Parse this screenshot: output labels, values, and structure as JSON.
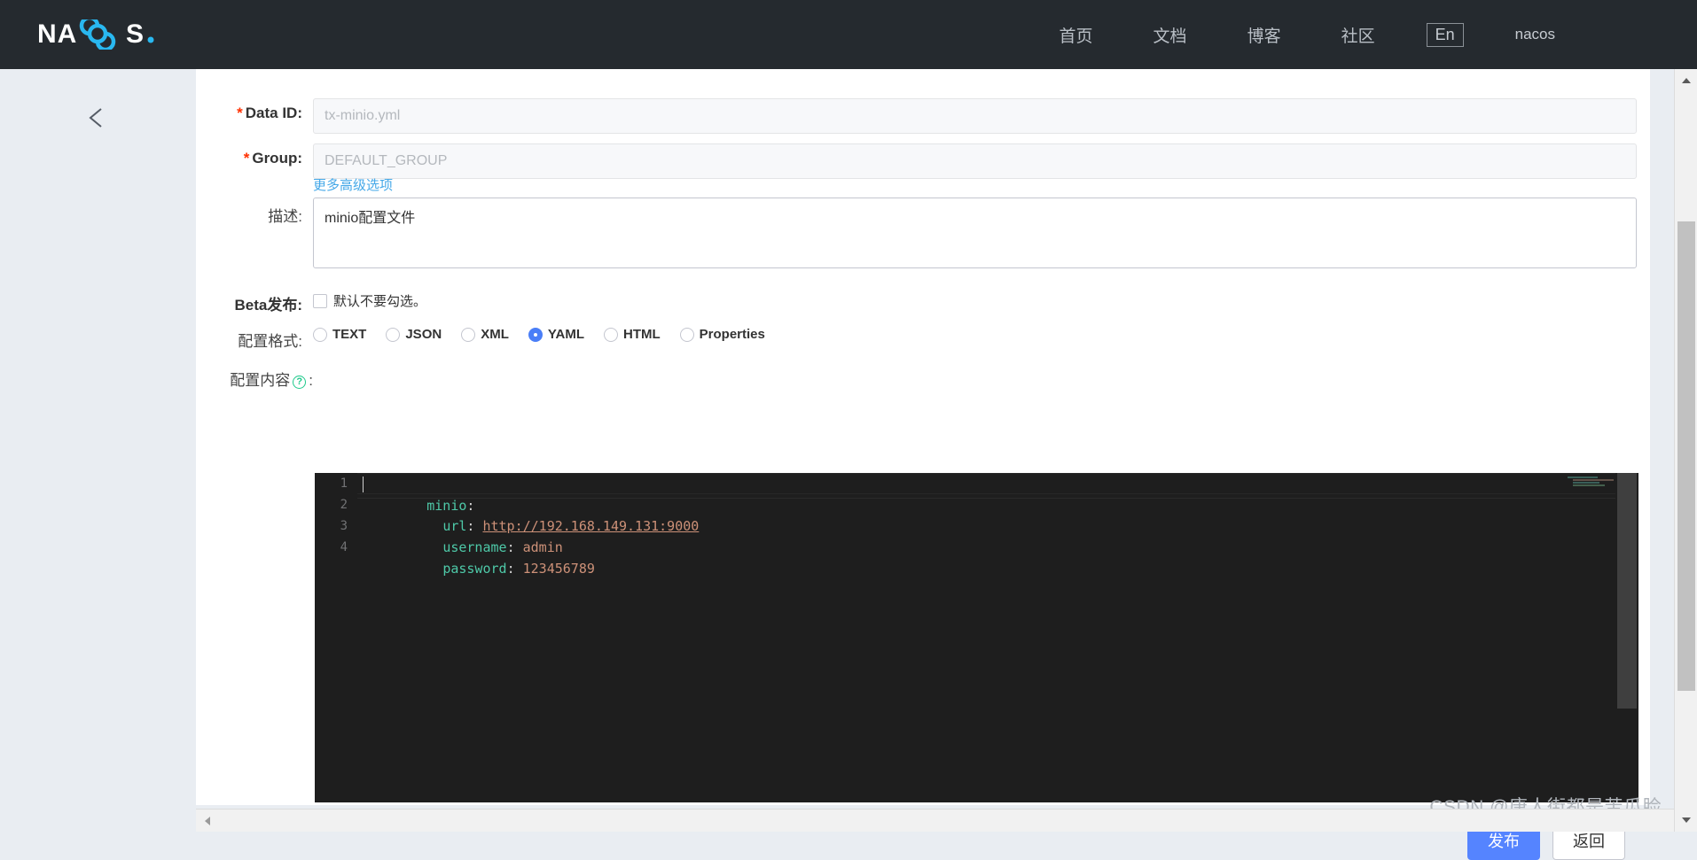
{
  "brand": {
    "name": "NACOS."
  },
  "topnav": {
    "links": [
      {
        "label": "首页"
      },
      {
        "label": "文档"
      },
      {
        "label": "博客"
      },
      {
        "label": "社区"
      }
    ],
    "language_toggle": "En",
    "user": "nacos"
  },
  "form": {
    "back_icon": "chevron-left-icon",
    "data_id": {
      "label": "Data ID:",
      "required_mark": "*",
      "value": "tx-minio.yml"
    },
    "group": {
      "label": "Group:",
      "required_mark": "*",
      "value": "DEFAULT_GROUP"
    },
    "advanced_link": "更多高级选项",
    "description": {
      "label": "描述:",
      "value": "minio配置文件"
    },
    "beta": {
      "label": "Beta发布:",
      "checkbox_text": "默认不要勾选。",
      "checked": false
    },
    "config_format": {
      "label": "配置格式:",
      "selected": "YAML",
      "options": [
        "TEXT",
        "JSON",
        "XML",
        "YAML",
        "HTML",
        "Properties"
      ]
    },
    "config_content": {
      "label_prefix": "配置内容",
      "help_icon": "?",
      "label_suffix": ":"
    }
  },
  "editor": {
    "line_numbers": [
      "1",
      "2",
      "3",
      "4"
    ],
    "lines": [
      {
        "key": "minio",
        "colon": ":",
        "value": "",
        "indent": ""
      },
      {
        "key": "url",
        "colon": ":",
        "value": "http://192.168.149.131:9000",
        "indent": "  ",
        "is_link": true
      },
      {
        "key": "username",
        "colon": ":",
        "value": "admin",
        "indent": "  "
      },
      {
        "key": "password",
        "colon": ":",
        "value": "123456789",
        "indent": "  "
      }
    ],
    "raw_text": "minio:\n  url: http://192.168.149.131:9000\n  username: admin\n  password: 123456789"
  },
  "actions": {
    "publish": "发布",
    "back": "返回"
  },
  "watermark": "CSDN @唐人街都是苦瓜脸",
  "colors": {
    "nav_bg": "#252a2f",
    "accent_blue": "#5584ff",
    "link_blue": "#45a8e8",
    "required_red": "#ff3000",
    "editor_bg": "#1e1e1e",
    "code_key": "#4ec9a8",
    "code_value": "#cd9178",
    "help_green": "#1ec98b"
  }
}
